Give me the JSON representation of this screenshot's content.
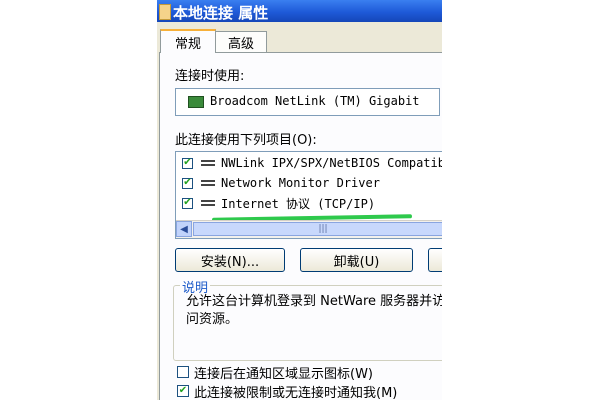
{
  "window": {
    "title": "本地连接 属性"
  },
  "tabs": [
    {
      "label": "常规",
      "active": true
    },
    {
      "label": "高级",
      "active": false
    }
  ],
  "connect_using": {
    "label": "连接时使用:",
    "adapter": "Broadcom NetLink (TM) Gigabit"
  },
  "items_section": {
    "label": "此连接使用下列项目(O):",
    "items": [
      {
        "label": "NWLink IPX/SPX/NetBIOS Compatib",
        "checked": true
      },
      {
        "label": "Network Monitor Driver",
        "checked": true
      },
      {
        "label": "Internet 协议 (TCP/IP)",
        "checked": true
      }
    ],
    "highlight_color": "#2ec94c"
  },
  "buttons": {
    "install": "安装(N)...",
    "uninstall": "卸载(U)"
  },
  "description": {
    "title": "说明",
    "text": "允许这台计算机登录到 NetWare 服务器并访问资源。"
  },
  "options": [
    {
      "label": "连接后在通知区域显示图标(W)",
      "checked": false
    },
    {
      "label": "此连接被限制或无连接时通知我(M)",
      "checked": true
    }
  ],
  "colors": {
    "titlebar": "#1e5ad8",
    "dialog_bg": "#ece9d8",
    "group_title": "#1d5bc9"
  }
}
